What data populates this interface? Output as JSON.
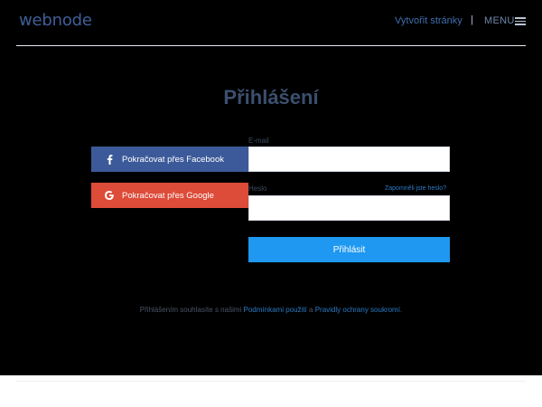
{
  "header": {
    "logo": "webnode",
    "create_link": "Vytvořit stránky",
    "separator": "|",
    "menu_label": "MENU"
  },
  "title": "Přihlášení",
  "social": {
    "facebook_label": "Pokračovat přes Facebook",
    "google_label": "Pokračovat přes Google"
  },
  "form": {
    "email_label": "E-mail",
    "email_value": "",
    "password_label": "Heslo",
    "password_value": "",
    "forgot_label": "Zapomněli jste heslo?",
    "submit_label": "Přihlásit"
  },
  "terms": {
    "prefix": "Přihlášením souhlasíte s našimi ",
    "terms_link": "Podmínkami použití",
    "conjunction": " a ",
    "privacy_link": "Pravidly ochrany soukromí",
    "suffix": "."
  },
  "colors": {
    "facebook": "#3c5a9a",
    "google": "#dd4b39",
    "submit": "#1e98f0",
    "link": "#2b7ac4"
  }
}
